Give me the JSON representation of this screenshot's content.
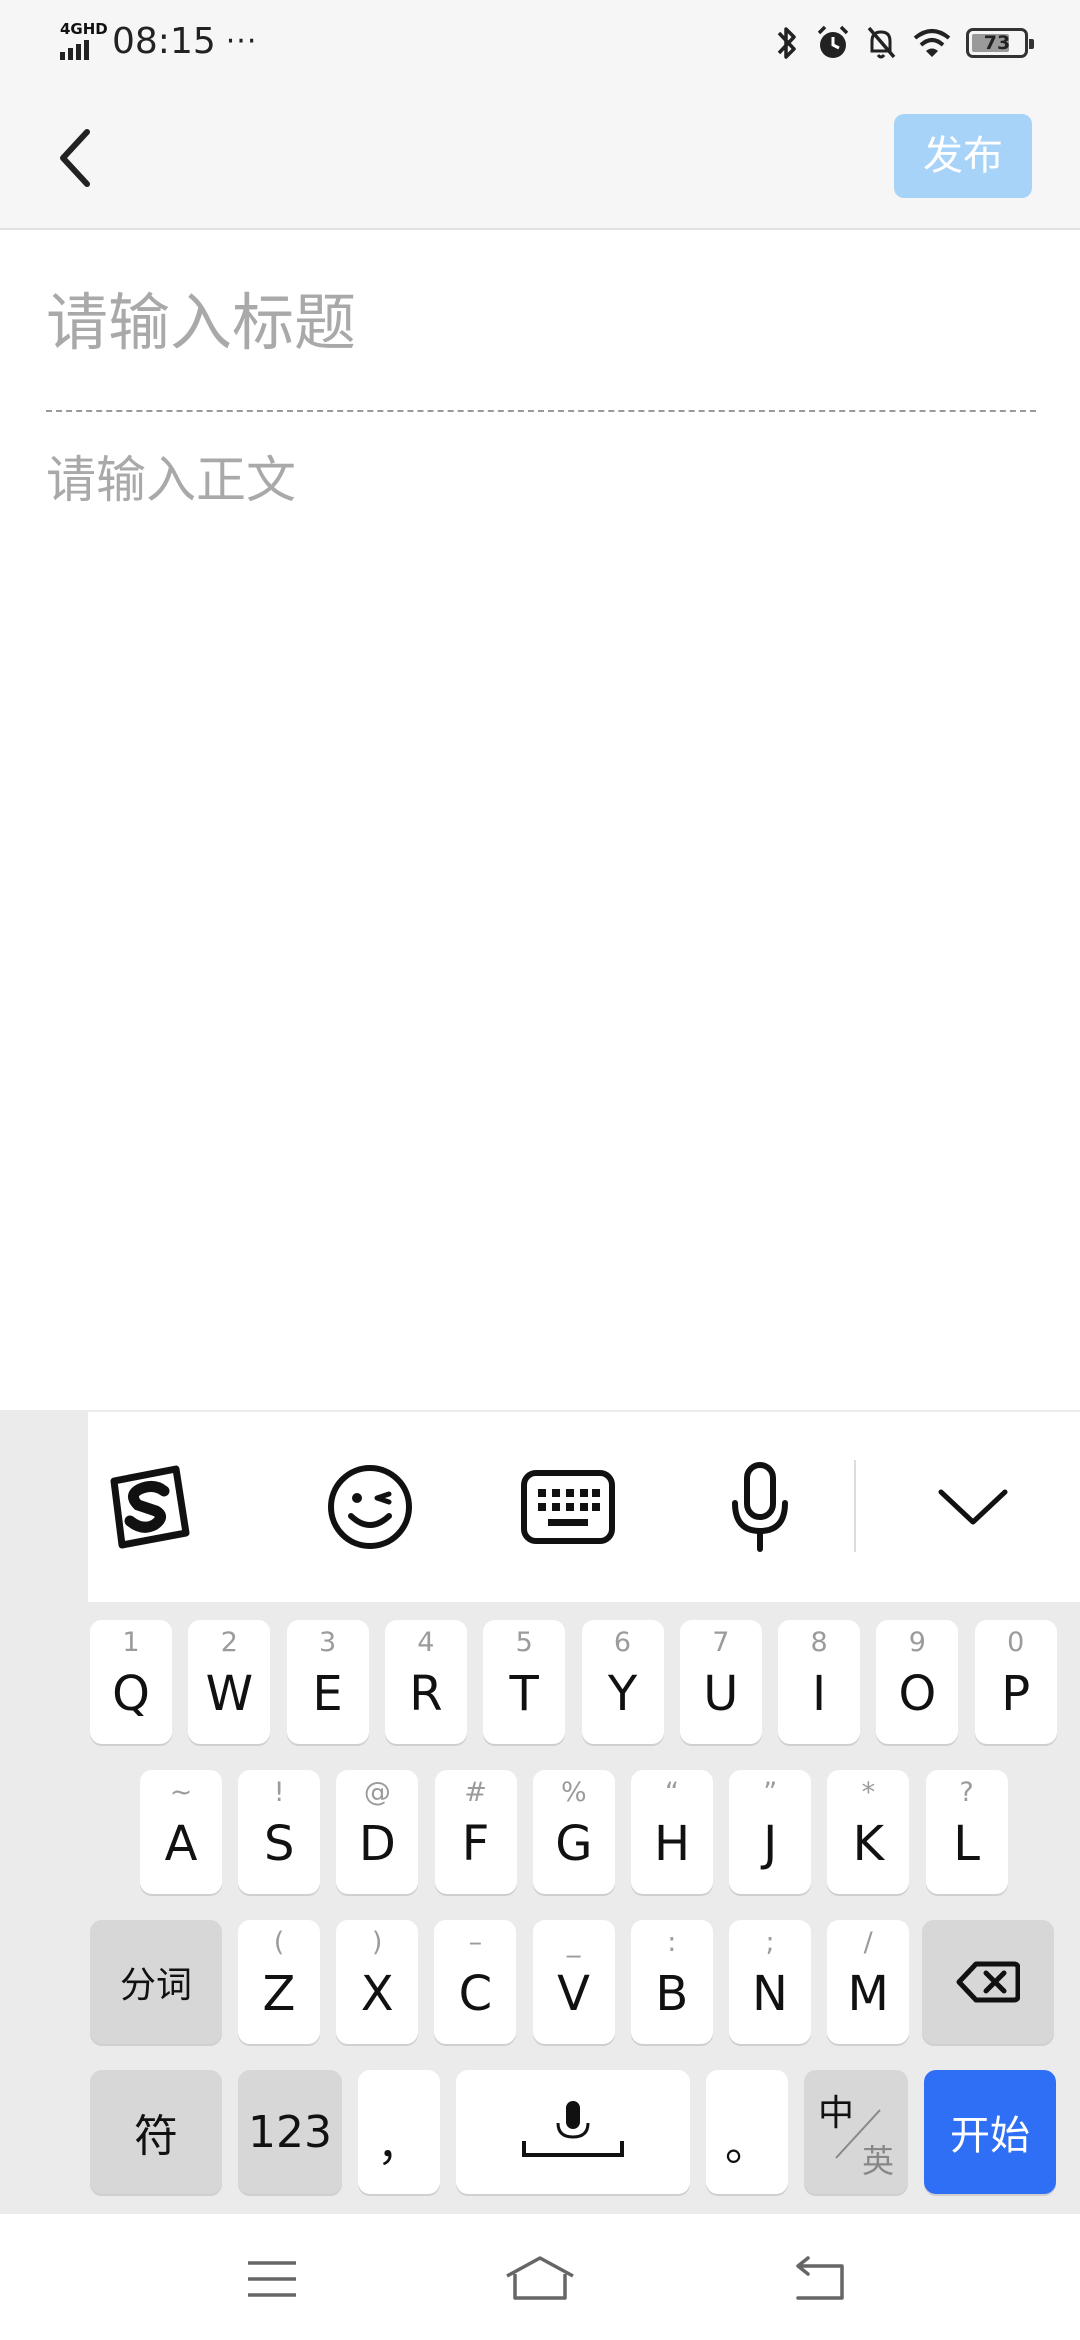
{
  "status_bar": {
    "network": "4GHD",
    "time": "08:15",
    "more": "···",
    "battery": "73",
    "icons": [
      "bluetooth-icon",
      "alarm-icon",
      "mute-icon",
      "wifi-icon",
      "battery-icon"
    ]
  },
  "nav": {
    "back_icon": "chevron-left-icon",
    "publish_label": "发布",
    "publish_color": "#a8d3f8"
  },
  "editor": {
    "title_placeholder": "请输入标题",
    "body_placeholder": "请输入正文"
  },
  "keyboard": {
    "toolbar": [
      "sogou-logo-icon",
      "emoji-icon",
      "keyboard-icon",
      "microphone-icon",
      "chevron-down-icon"
    ],
    "row1": [
      {
        "hint": "1",
        "key": "Q"
      },
      {
        "hint": "2",
        "key": "W"
      },
      {
        "hint": "3",
        "key": "E"
      },
      {
        "hint": "4",
        "key": "R"
      },
      {
        "hint": "5",
        "key": "T"
      },
      {
        "hint": "6",
        "key": "Y"
      },
      {
        "hint": "7",
        "key": "U"
      },
      {
        "hint": "8",
        "key": "I"
      },
      {
        "hint": "9",
        "key": "O"
      },
      {
        "hint": "0",
        "key": "P"
      }
    ],
    "row2": [
      {
        "hint": "~",
        "key": "A"
      },
      {
        "hint": "!",
        "key": "S"
      },
      {
        "hint": "@",
        "key": "D"
      },
      {
        "hint": "#",
        "key": "F"
      },
      {
        "hint": "%",
        "key": "G"
      },
      {
        "hint": "“",
        "key": "H"
      },
      {
        "hint": "”",
        "key": "J"
      },
      {
        "hint": "*",
        "key": "K"
      },
      {
        "hint": "?",
        "key": "L"
      }
    ],
    "row3_left": "分词",
    "row3": [
      {
        "hint": "(",
        "key": "Z"
      },
      {
        "hint": ")",
        "key": "X"
      },
      {
        "hint": "–",
        "key": "C"
      },
      {
        "hint": "_",
        "key": "V"
      },
      {
        "hint": ":",
        "key": "B"
      },
      {
        "hint": ";",
        "key": "N"
      },
      {
        "hint": "/",
        "key": "M"
      }
    ],
    "symbols_label": "符",
    "numbers_label": "123",
    "comma_label": "，",
    "period_label": "。",
    "lang_top": "中",
    "lang_bottom": "英",
    "enter_label": "开始",
    "enter_color": "#2e6ff6"
  },
  "system_nav": [
    "menu-icon",
    "home-icon",
    "back-icon"
  ]
}
